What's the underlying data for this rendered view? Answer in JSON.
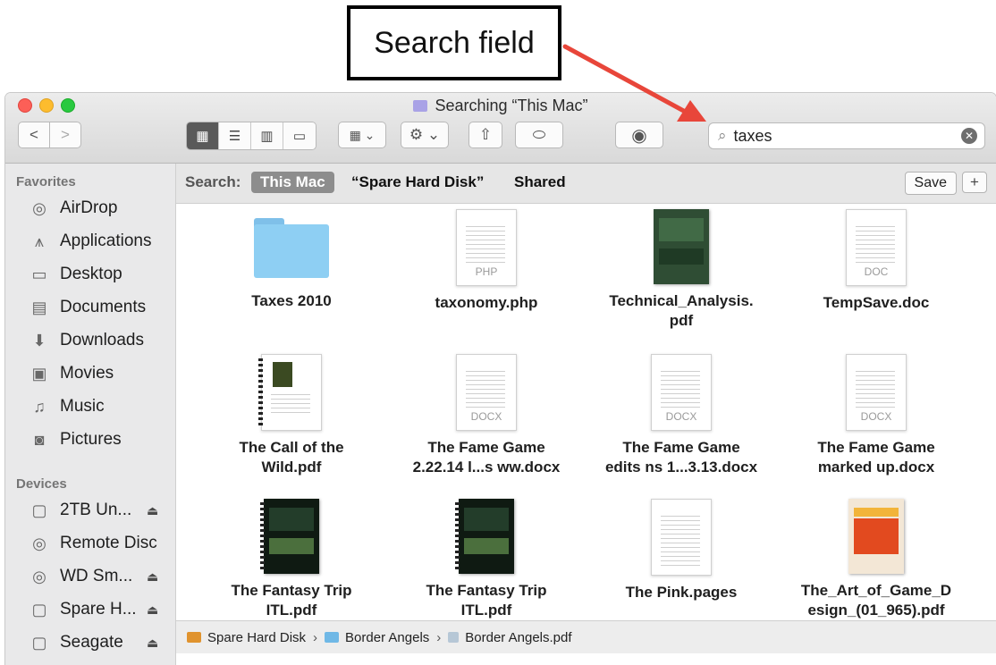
{
  "callout": {
    "label": "Search field"
  },
  "window": {
    "title": "Searching “This Mac”",
    "nav": {
      "back": "<",
      "forward": ">"
    },
    "toolbar": {
      "arrange_icon": "arrange-icon",
      "action_icon": "gear-icon",
      "share_icon": "share-icon",
      "tags_icon": "tag-icon",
      "quicklook_icon": "eye-icon"
    },
    "search": {
      "value": "taxes",
      "placeholder": "Search"
    }
  },
  "sidebar": {
    "favorites_heading": "Favorites",
    "favorites": [
      {
        "label": "AirDrop",
        "icon": "airdrop-icon"
      },
      {
        "label": "Applications",
        "icon": "applications-icon"
      },
      {
        "label": "Desktop",
        "icon": "desktop-icon"
      },
      {
        "label": "Documents",
        "icon": "documents-icon"
      },
      {
        "label": "Downloads",
        "icon": "downloads-icon"
      },
      {
        "label": "Movies",
        "icon": "movies-icon"
      },
      {
        "label": "Music",
        "icon": "music-icon"
      },
      {
        "label": "Pictures",
        "icon": "pictures-icon"
      }
    ],
    "devices_heading": "Devices",
    "devices": [
      {
        "label": "2TB Un...",
        "icon": "disk-icon",
        "eject": "⏏"
      },
      {
        "label": "Remote Disc",
        "icon": "disc-icon",
        "eject": ""
      },
      {
        "label": "WD Sm...",
        "icon": "disc-icon",
        "eject": "⏏"
      },
      {
        "label": "Spare H...",
        "icon": "disk-icon",
        "eject": "⏏"
      },
      {
        "label": "Seagate",
        "icon": "disk-icon",
        "eject": "⏏"
      }
    ]
  },
  "scope": {
    "label": "Search:",
    "selected": "This Mac",
    "option_disk": "“Spare Hard Disk”",
    "option_shared": "Shared",
    "save": "Save",
    "add": "+"
  },
  "files": [
    {
      "name": "Taxes 2010",
      "kind": "folder"
    },
    {
      "name": "taxonomy.php",
      "kind": "page",
      "ext": "PHP"
    },
    {
      "name": "Technical_Analysis.\npdf",
      "kind": "book"
    },
    {
      "name": "TempSave.doc",
      "kind": "page",
      "ext": "DOC"
    },
    {
      "name": "The Call of the\nWild.pdf",
      "kind": "spiral"
    },
    {
      "name": "The Fame Game\n2.22.14 l...s ww.docx",
      "kind": "page",
      "ext": "DOCX"
    },
    {
      "name": "The Fame Game\nedits ns 1...3.13.docx",
      "kind": "page",
      "ext": "DOCX"
    },
    {
      "name": "The Fame Game\nmarked up.docx",
      "kind": "page",
      "ext": "DOCX"
    },
    {
      "name": "The Fantasy Trip\nITL.pdf",
      "kind": "dark"
    },
    {
      "name": "The Fantasy Trip\nITL.pdf",
      "kind": "dark"
    },
    {
      "name": "The Pink.pages",
      "kind": "page",
      "ext": ""
    },
    {
      "name": "The_Art_of_Game_D\nesign_(01_965).pdf",
      "kind": "art"
    }
  ],
  "pathbar": {
    "items": [
      {
        "label": "Spare Hard Disk",
        "icon": "hard-disk-icon",
        "color": "#e0932e"
      },
      {
        "label": "Border Angels",
        "icon": "folder-icon",
        "color": "#6fb8e6"
      },
      {
        "label": "Border Angels.pdf",
        "icon": "pdf-icon",
        "color": "#b6c7d6"
      }
    ],
    "separator": "›"
  },
  "colors": {
    "arrow": "#e8463a",
    "selected_view": "#5a5a5a",
    "scope_pill": "#8d8d8d"
  }
}
